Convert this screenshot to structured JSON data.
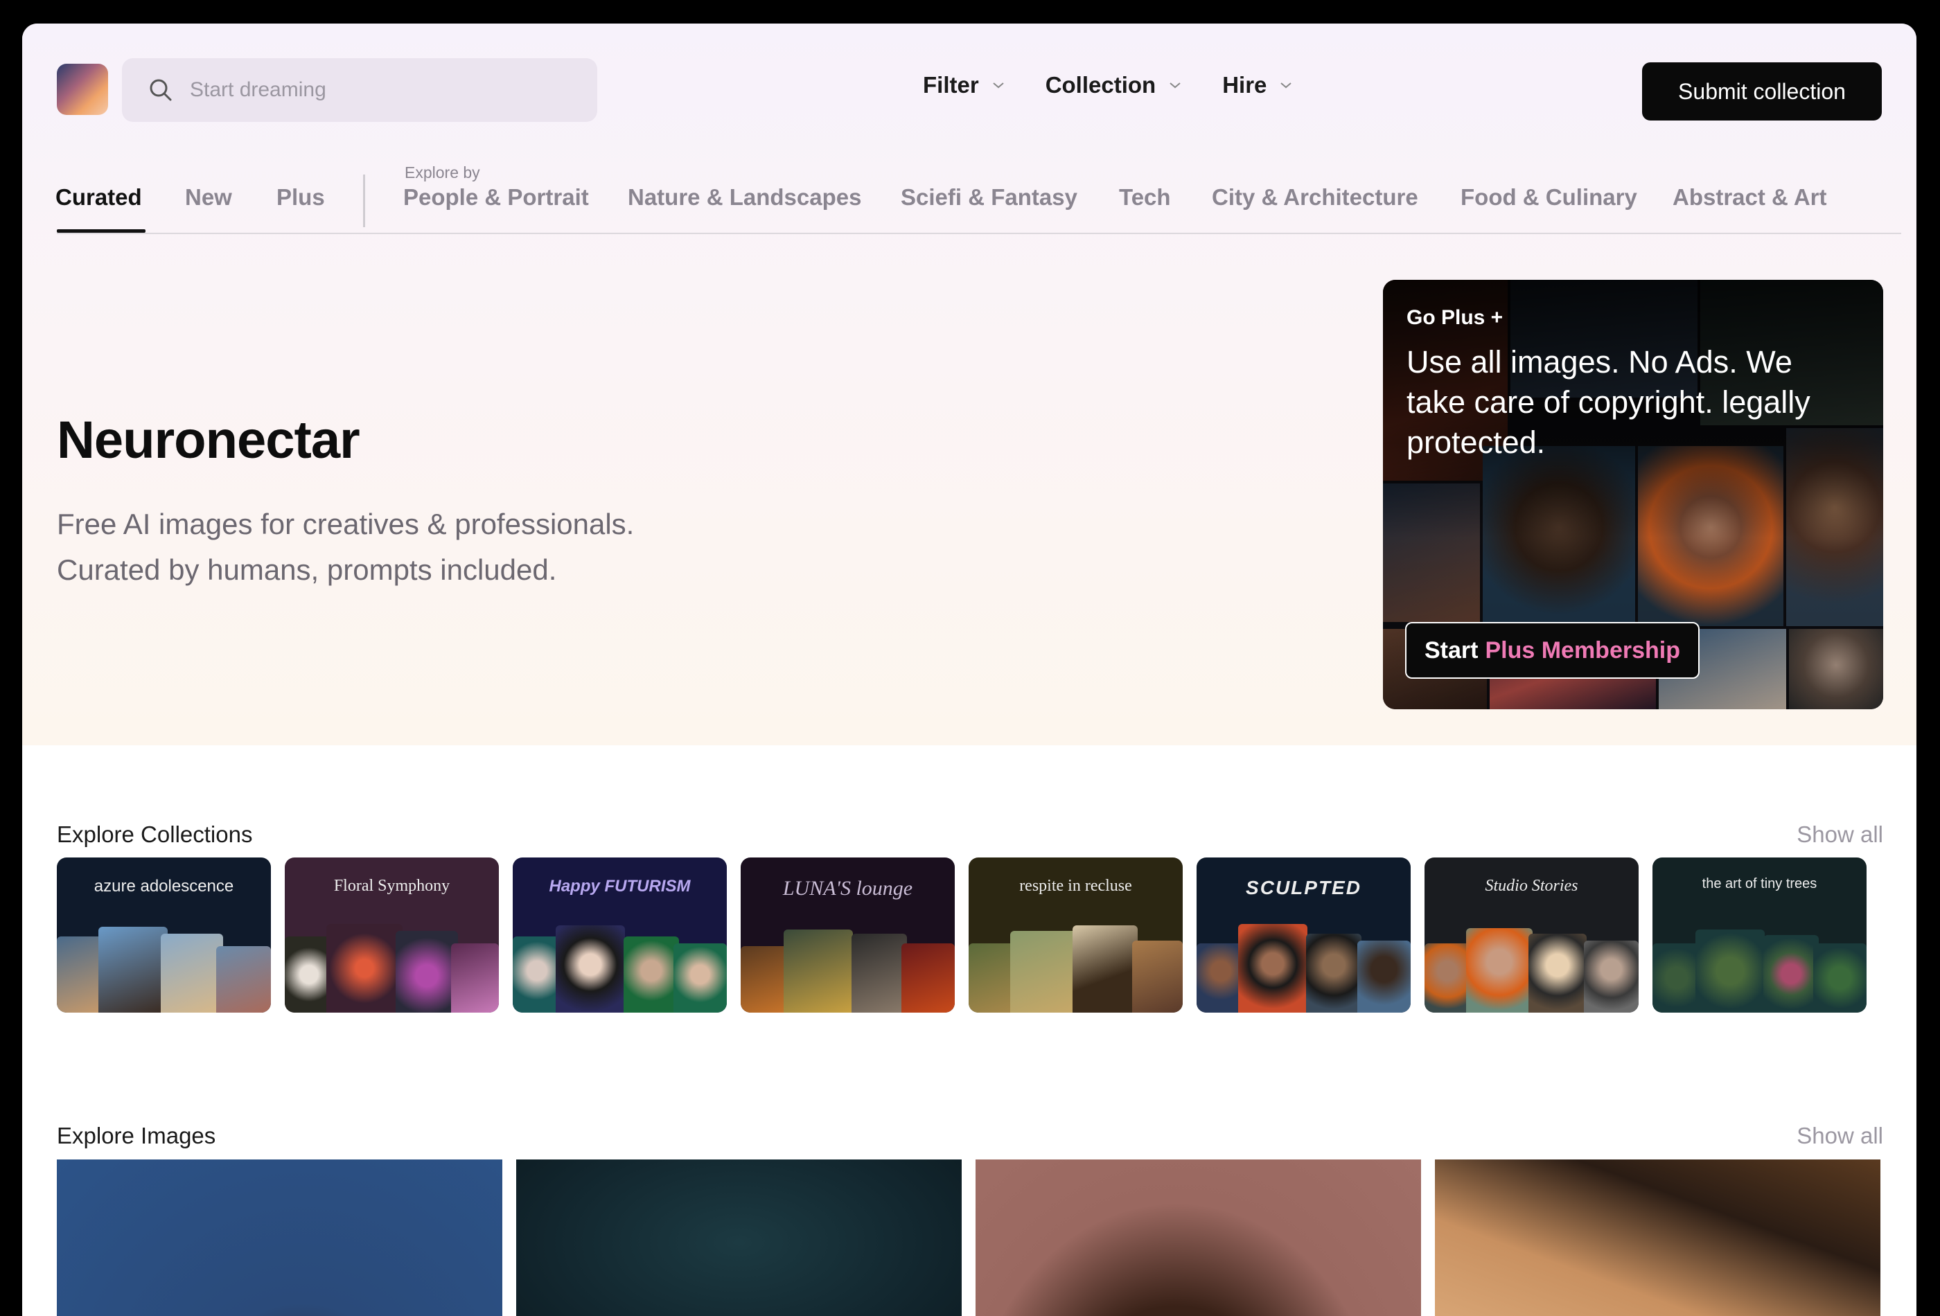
{
  "header": {
    "search_placeholder": "Start dreaming",
    "menus": [
      {
        "label": "Filter"
      },
      {
        "label": "Collection"
      },
      {
        "label": "Hire"
      }
    ],
    "submit_label": "Submit collection"
  },
  "tabs": {
    "primary": [
      "Curated",
      "New",
      "Plus"
    ],
    "explore_by_label": "Explore by",
    "categories": [
      "People & Portrait",
      "Nature & Landscapes",
      "Sciefi & Fantasy",
      "Tech",
      "City & Architecture",
      "Food & Culinary",
      "Abstract & Art"
    ]
  },
  "hero": {
    "title": "Neuronectar",
    "subtitle_line1": "Free AI images for creatives & professionals.",
    "subtitle_line2": "Curated by humans, prompts included."
  },
  "promo": {
    "kicker": "Go Plus +",
    "text": "Use all images. No Ads. We take care of copyright. legally protected.",
    "button_start": "Start",
    "button_rest": "Plus Membership"
  },
  "collections_section": {
    "title": "Explore Collections",
    "show_all": "Show all",
    "items": [
      {
        "title": "azure adolescence",
        "bg": "#0f1a2b"
      },
      {
        "title": "Floral Symphony",
        "bg": "#3b2235"
      },
      {
        "title": "Happy FUTURISM",
        "bg": "#16163f"
      },
      {
        "title": "LUNA'S lounge",
        "bg": "#1a0f1e"
      },
      {
        "title": "respite in recluse",
        "bg": "#2b2612"
      },
      {
        "title": "SCULPTED",
        "bg": "#0e1a2a"
      },
      {
        "title": "Studio Stories",
        "bg": "#1a1c20"
      },
      {
        "title": "the art of tiny trees",
        "bg": "#132224"
      }
    ]
  },
  "images_section": {
    "title": "Explore Images",
    "show_all": "Show all"
  },
  "colors": {
    "accent_pink": "#ef7ab5",
    "button_dark": "#0a0a0a"
  }
}
